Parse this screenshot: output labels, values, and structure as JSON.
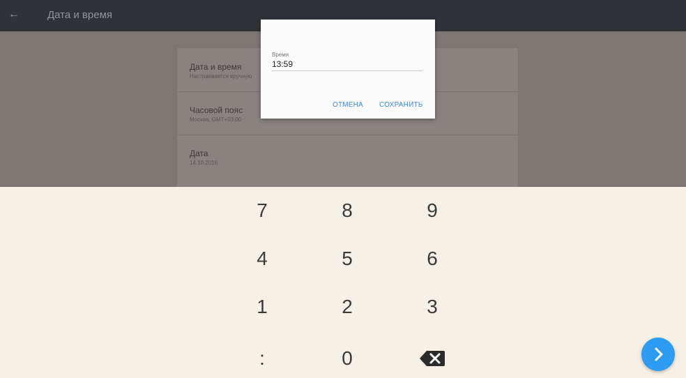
{
  "appbar": {
    "title": "Дата и время",
    "back_icon": "arrow-left-icon"
  },
  "settings": [
    {
      "title": "Дата и время",
      "subtitle": "Настраивается вручную"
    },
    {
      "title": "Часовой пояс",
      "subtitle": "Москва, GMT+03:00"
    },
    {
      "title": "Дата",
      "subtitle": "14.10.2016"
    }
  ],
  "dialog": {
    "label": "Время",
    "value": "13:59",
    "cancel_label": "ОТМЕНА",
    "save_label": "СОХРАНИТЬ"
  },
  "keyboard": {
    "keys": [
      "7",
      "8",
      "9",
      "4",
      "5",
      "6",
      "1",
      "2",
      "3",
      ":",
      "0"
    ],
    "backspace_icon": "backspace-icon",
    "next_icon": "chevron-right-icon"
  },
  "colors": {
    "appbar": "#2f3338",
    "accent": "#2d9bf0",
    "dialog_button": "#3d8ed6",
    "keyboard_bg": "#f7f0e7"
  }
}
